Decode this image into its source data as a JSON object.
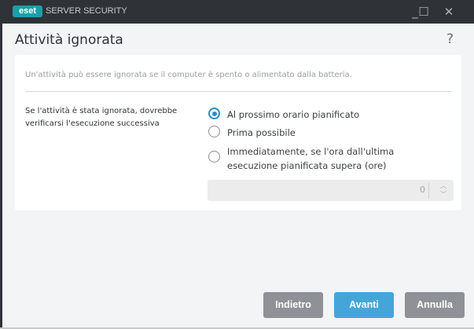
{
  "window": {
    "logo": "eset",
    "app_name": "SERVER SECURITY",
    "minimize": "_",
    "maximize": "☐",
    "close": "✕"
  },
  "header": {
    "title": "Attività ignorata",
    "help": "?"
  },
  "card": {
    "description": "Un'attività può essere ignorata se il computer è spento o alimentato dalla batteria.",
    "label": "Se l'attività è stata ignorata, dovrebbe verificarsi l'esecuzione successiva",
    "options": [
      {
        "label": "Al prossimo orario pianificato",
        "selected": true
      },
      {
        "label": "Prima possibile",
        "selected": false
      },
      {
        "label": "Immediatamente, se l'ora dall'ultima esecuzione pianificata supera (ore)",
        "selected": false
      }
    ],
    "hours_value": "0",
    "spin_up": "︿",
    "spin_down": "﹀"
  },
  "buttons": {
    "back": "Indietro",
    "next": "Avanti",
    "cancel": "Annulla"
  },
  "colors": {
    "accent": "#2b8cc4",
    "next": "#44a6d8",
    "secondary": "#8e9297",
    "brand": "#1d9fa8"
  }
}
